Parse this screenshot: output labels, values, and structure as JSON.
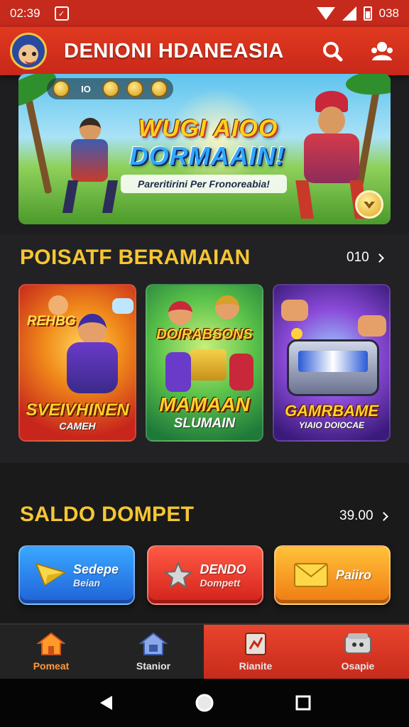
{
  "status_bar": {
    "time": "02:39",
    "battery": "038"
  },
  "header": {
    "title": "DENIONI HDANEASIA"
  },
  "banner": {
    "coin_label": "IO",
    "title_line1": "WUGI AIOO",
    "title_line2": "DORMAAIN!",
    "subtitle": "Pareritirini Per Fronoreabia!"
  },
  "games_section": {
    "title": "POISATF BERAMAIAN",
    "more_label": "010",
    "cards": [
      {
        "tag": "REHBG",
        "title": "SVEIVHINEN",
        "subtitle": "CAMEH"
      },
      {
        "tag": "DOIRABSONS",
        "title": "MAMAAN",
        "subtitle": "SLUMAIN"
      },
      {
        "tag": "",
        "title": "GAMRBAME",
        "subtitle": "YIAIO DOIOCAE"
      }
    ]
  },
  "wallet_section": {
    "title": "SALDO DOMPET",
    "more_label": "39.00",
    "buttons": [
      {
        "line1": "Sedepe",
        "line2": "Beian"
      },
      {
        "line1": "DENDO",
        "line2": "Dompett"
      },
      {
        "line1": "Paiiro",
        "line2": ""
      }
    ]
  },
  "bottom_nav": [
    {
      "label": "Pomeat",
      "icon": "home-icon",
      "active": true
    },
    {
      "label": "Stanior",
      "icon": "store-icon",
      "active": false
    },
    {
      "label": "Rianite",
      "icon": "document-icon",
      "active": false
    },
    {
      "label": "Osapie",
      "icon": "wallet-icon",
      "active": false
    }
  ],
  "colors": {
    "primary": "#d32f1e",
    "gold": "#f6c633",
    "background": "#1e1e20"
  }
}
